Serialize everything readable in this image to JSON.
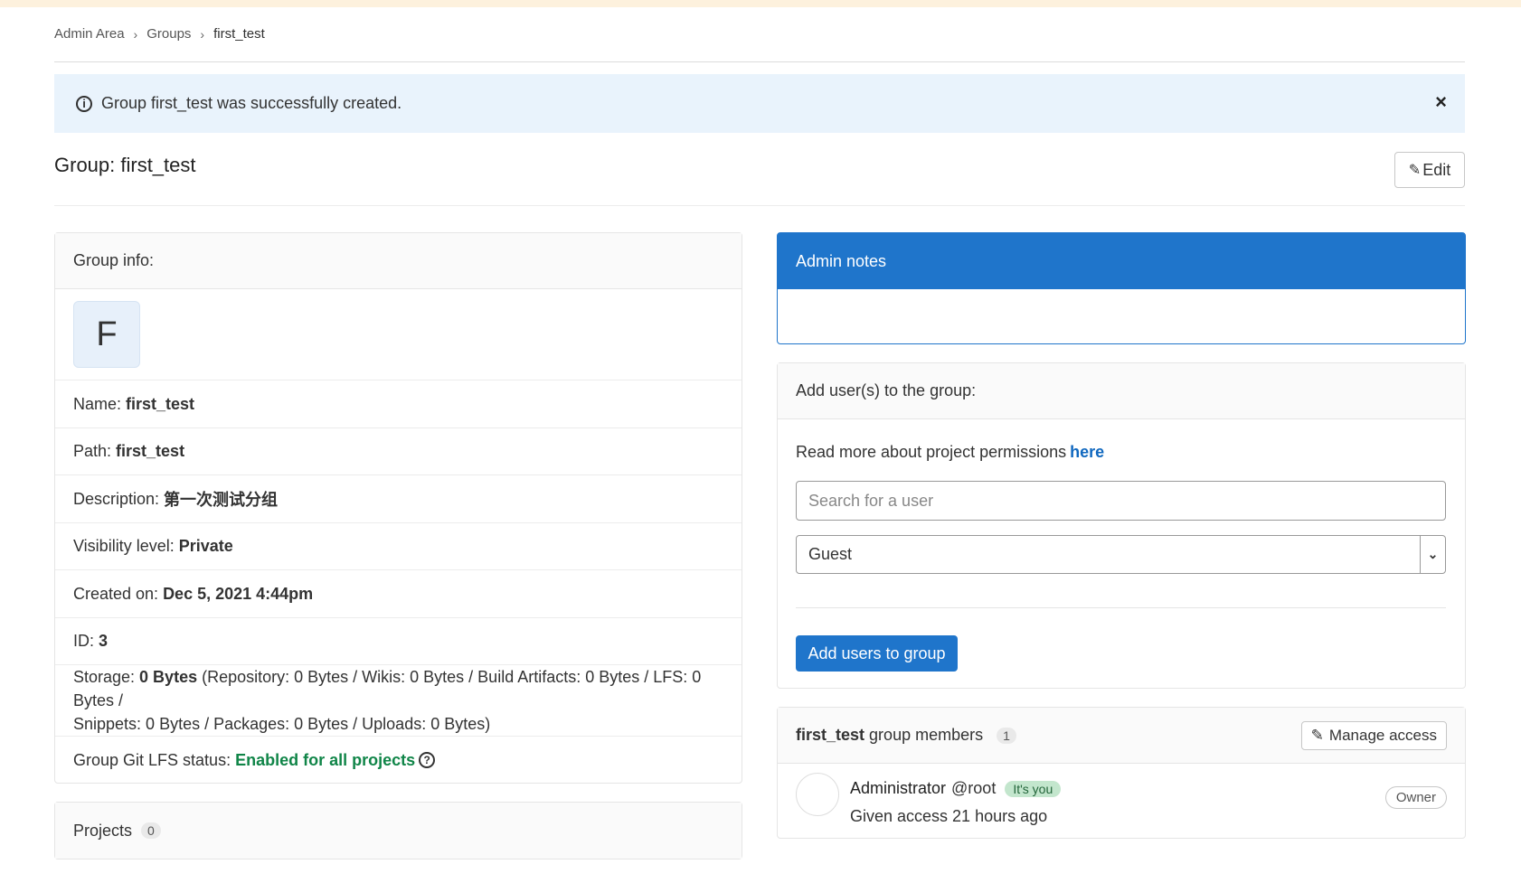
{
  "breadcrumb": {
    "items": [
      "Admin Area",
      "Groups",
      "first_test"
    ]
  },
  "alert": {
    "message": "Group first_test was successfully created.",
    "close": "×"
  },
  "page": {
    "title": "Group: first_test",
    "edit_label": "Edit"
  },
  "group_info": {
    "header": "Group info:",
    "avatar_letter": "F",
    "name_label": "Name:",
    "name_value": "first_test",
    "path_label": "Path:",
    "path_value": "first_test",
    "description_label": "Description:",
    "description_value": "第一次测试分组",
    "visibility_label": "Visibility level:",
    "visibility_value": "Private",
    "created_label": "Created on:",
    "created_value": "Dec 5, 2021 4:44pm",
    "id_label": "ID:",
    "id_value": "3",
    "storage_label": "Storage:",
    "storage_value": "0 Bytes",
    "storage_detail_1": "(Repository: 0 Bytes / Wikis: 0 Bytes / Build Artifacts: 0 Bytes / LFS: 0 Bytes /",
    "storage_detail_2": "Snippets: 0 Bytes / Packages: 0 Bytes / Uploads: 0 Bytes)",
    "lfs_label": "Group Git LFS status:",
    "lfs_value": "Enabled for all projects"
  },
  "projects": {
    "label": "Projects",
    "count": "0"
  },
  "admin_notes": {
    "header": "Admin notes"
  },
  "add_users": {
    "header": "Add user(s) to the group:",
    "permissions_text": "Read more about project permissions",
    "permissions_link": "here",
    "search_placeholder": "Search for a user",
    "role_selected": "Guest",
    "button_label": "Add users to group"
  },
  "members": {
    "group_name": "first_test",
    "header_suffix": "group members",
    "count": "1",
    "manage_label": "Manage access",
    "list": [
      {
        "name": "Administrator",
        "username": "@root",
        "badge": "It's you",
        "given": "Given access 21 hours ago",
        "role": "Owner"
      }
    ]
  },
  "colors": {
    "primary": "#1f75cb",
    "success": "#108548",
    "alert_bg": "#e9f3fc",
    "topbar": "#fdf1dd"
  }
}
